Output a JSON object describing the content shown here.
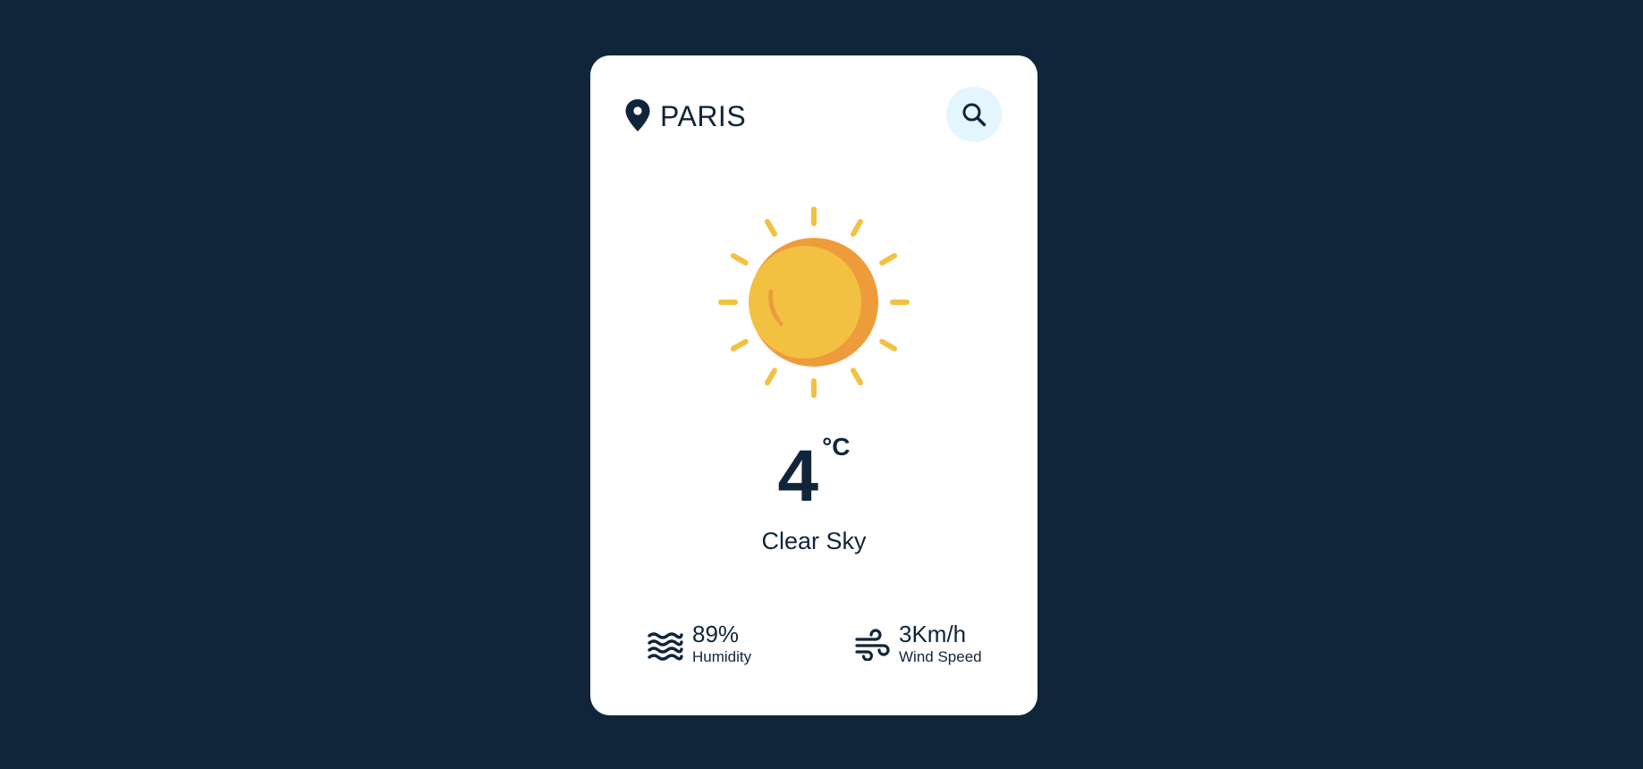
{
  "location": {
    "city": "PARIS",
    "icon": "map-pin-icon"
  },
  "search": {
    "icon": "search-icon"
  },
  "weather": {
    "icon": "sun-icon",
    "temperature": "4",
    "unit": "°C",
    "condition": "Clear Sky"
  },
  "stats": {
    "humidity": {
      "icon": "waves-icon",
      "value": "89%",
      "label": "Humidity"
    },
    "wind": {
      "icon": "wind-icon",
      "value": "3Km/h",
      "label": "Wind Speed"
    }
  },
  "colors": {
    "background": "#10253a",
    "card": "#ffffff",
    "text": "#10253a",
    "search_bg": "#e3f5fd",
    "sun": "#f2c142",
    "sun_shade": "#ee9b3b"
  }
}
